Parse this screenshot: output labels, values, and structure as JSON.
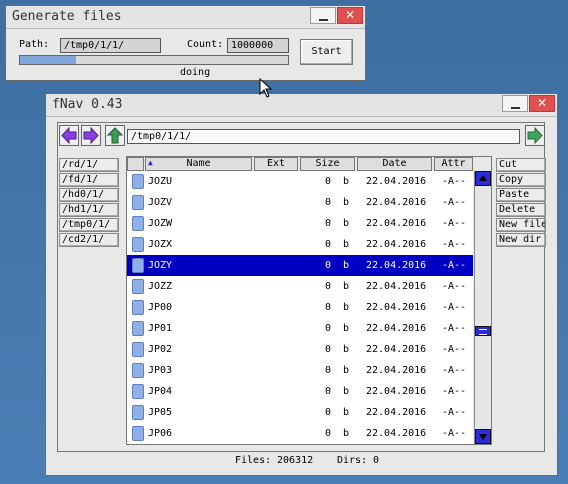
{
  "gen_window": {
    "title": "Generate files",
    "close_glyph": "✕",
    "path_label": "Path:",
    "path_value": "/tmp0/1/1/",
    "count_label": "Count:",
    "count_value": "1000000",
    "start_label": "Start",
    "progress_fraction": 0.21,
    "status_text": "doing"
  },
  "fnav": {
    "title": "fNav 0.43",
    "close_glyph": "✕",
    "current_path": "/tmp0/1/1/",
    "drives": [
      "/rd/1/",
      "/fd/1/",
      "/hd0/1/",
      "/hd1/1/",
      "/tmp0/1/",
      "/cd2/1/"
    ],
    "actions": [
      "Cut",
      "Copy",
      "Paste",
      "Delete",
      "New file",
      "New dir"
    ],
    "columns": {
      "name": "Name",
      "ext": "Ext",
      "size": "Size",
      "date": "Date",
      "attr": "Attr"
    },
    "sort_indicator": "▲",
    "files": [
      {
        "name": "JOZU",
        "size": "0",
        "unit": "b",
        "date": "22.04.2016",
        "attr": "-A--",
        "selected": false
      },
      {
        "name": "JOZV",
        "size": "0",
        "unit": "b",
        "date": "22.04.2016",
        "attr": "-A--",
        "selected": false
      },
      {
        "name": "JOZW",
        "size": "0",
        "unit": "b",
        "date": "22.04.2016",
        "attr": "-A--",
        "selected": false
      },
      {
        "name": "JOZX",
        "size": "0",
        "unit": "b",
        "date": "22.04.2016",
        "attr": "-A--",
        "selected": false
      },
      {
        "name": "JOZY",
        "size": "0",
        "unit": "b",
        "date": "22.04.2016",
        "attr": "-A--",
        "selected": true
      },
      {
        "name": "JOZZ",
        "size": "0",
        "unit": "b",
        "date": "22.04.2016",
        "attr": "-A--",
        "selected": false
      },
      {
        "name": "JP00",
        "size": "0",
        "unit": "b",
        "date": "22.04.2016",
        "attr": "-A--",
        "selected": false
      },
      {
        "name": "JP01",
        "size": "0",
        "unit": "b",
        "date": "22.04.2016",
        "attr": "-A--",
        "selected": false
      },
      {
        "name": "JP02",
        "size": "0",
        "unit": "b",
        "date": "22.04.2016",
        "attr": "-A--",
        "selected": false
      },
      {
        "name": "JP03",
        "size": "0",
        "unit": "b",
        "date": "22.04.2016",
        "attr": "-A--",
        "selected": false
      },
      {
        "name": "JP04",
        "size": "0",
        "unit": "b",
        "date": "22.04.2016",
        "attr": "-A--",
        "selected": false
      },
      {
        "name": "JP05",
        "size": "0",
        "unit": "b",
        "date": "22.04.2016",
        "attr": "-A--",
        "selected": false
      },
      {
        "name": "JP06",
        "size": "0",
        "unit": "b",
        "date": "22.04.2016",
        "attr": "-A--",
        "selected": false
      }
    ],
    "status_files_label": "Files:",
    "status_files_count": "206312",
    "status_dirs_label": "Dirs:",
    "status_dirs_count": "0",
    "scroll_fraction": 0.6
  },
  "colors": {
    "selection": "#0000c4",
    "progress_fill": "#7ea6d8",
    "scrollbar": "#2b2bd8",
    "back_arrow": "#8a3fe0",
    "forward_arrow": "#8a3fe0",
    "up_arrow": "#3c9a55",
    "go_arrow": "#3caa5a"
  },
  "icons": {
    "back": "arrow-left-icon",
    "forward": "arrow-right-icon",
    "up": "arrow-up-icon",
    "go": "go-arrow-icon",
    "file": "file-icon",
    "cursor": "mouse-pointer-icon"
  }
}
